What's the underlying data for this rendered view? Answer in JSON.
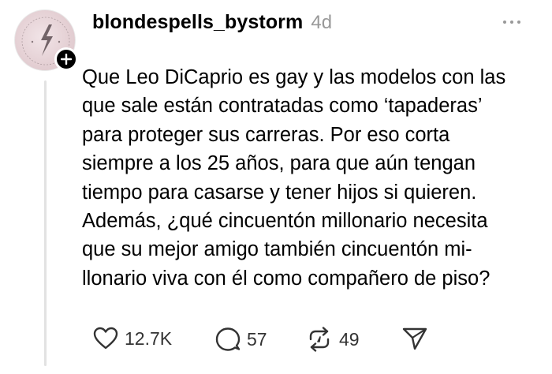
{
  "post": {
    "username": "blondespells_bystorm",
    "timestamp": "4d",
    "lines": [
      "Que Leo DiCaprio es gay y las modelos con las",
      "que sale están contratadas como ‘tapaderas’",
      "para proteger sus carreras. Por eso corta",
      "siempre a los 25 años, para que aún tengan",
      "tiempo para casarse y tener hijos si quieren.",
      "Además, ¿qué cincuentón millonario necesita",
      "que su mejor amigo también cincuentón mi-",
      "llonario viva con él como compañero de piso?"
    ]
  },
  "actions": {
    "likes": "12.7K",
    "replies": "57",
    "reposts": "49"
  },
  "icons": {
    "avatar": "avatar-image",
    "follow": "plus-icon",
    "more": "more-horizontal-icon",
    "like": "heart-icon",
    "reply": "comment-bubble-icon",
    "repost": "repost-icon",
    "share": "send-icon"
  }
}
